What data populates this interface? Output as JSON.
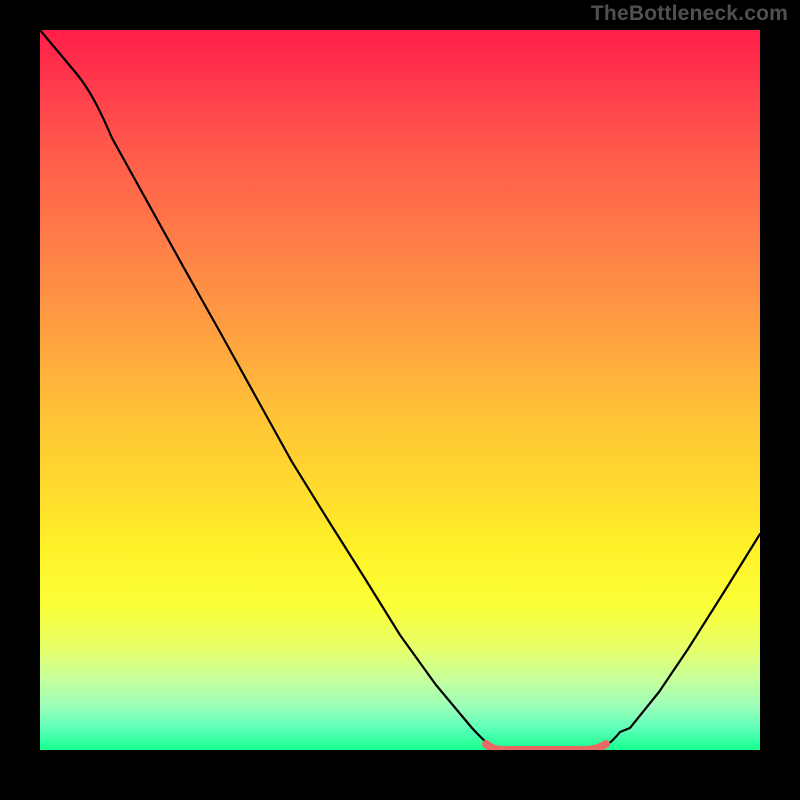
{
  "watermark": "TheBottleneck.com",
  "chart_data": {
    "type": "line",
    "x": [
      0.0,
      0.05,
      0.1,
      0.15,
      0.2,
      0.25,
      0.3,
      0.35,
      0.4,
      0.45,
      0.5,
      0.55,
      0.6,
      0.63,
      0.66,
      0.7,
      0.75,
      0.78,
      0.82,
      0.86,
      0.9,
      0.95,
      1.0
    ],
    "values": [
      1.0,
      0.94,
      0.85,
      0.76,
      0.67,
      0.58,
      0.49,
      0.4,
      0.32,
      0.24,
      0.16,
      0.09,
      0.03,
      0.005,
      0.0,
      0.0,
      0.0,
      0.005,
      0.03,
      0.08,
      0.14,
      0.22,
      0.3
    ],
    "title": "",
    "xlabel": "",
    "ylabel": "",
    "xlim": [
      0,
      1
    ],
    "ylim": [
      0,
      1
    ],
    "grid": false,
    "background": "rainbow-vertical-gradient",
    "accent_segment": {
      "comment": "short salmon-colored flat segment at valley bottom",
      "x_start": 0.62,
      "x_end": 0.79,
      "color": "#e96a63"
    },
    "colors": {
      "curve": "#000000",
      "accent": "#e96a63",
      "page_bg": "#000000",
      "gradient_top": "#ff1f4a",
      "gradient_bottom": "#18ff90"
    }
  }
}
